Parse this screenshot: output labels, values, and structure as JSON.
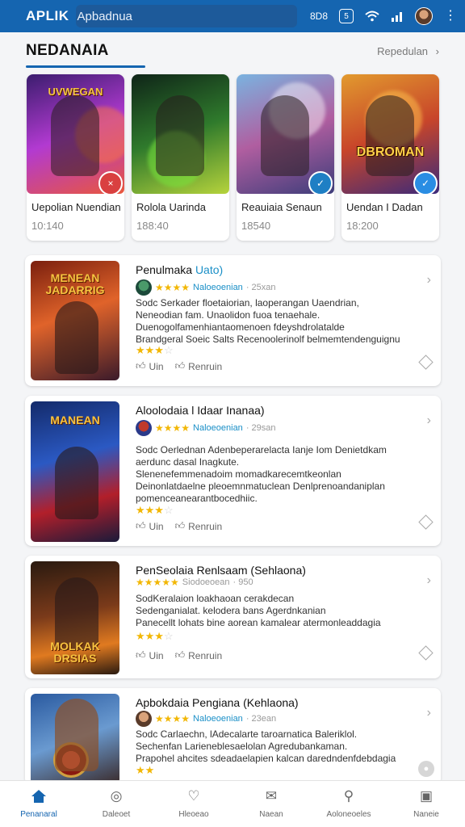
{
  "topbar": {
    "brand": "APLIK",
    "search_text": "Apbadnua",
    "status_label": "8D8",
    "status_icon": "5",
    "icons": [
      "wifi-icon",
      "signal-icon"
    ]
  },
  "section": {
    "title": "NEDANAIA",
    "link": "Repedulan"
  },
  "featured": [
    {
      "name": "Uepolian Nuendian",
      "time": "10:140",
      "accent": "#d94040",
      "badge": "×",
      "colors": [
        "#3b1d6e",
        "#b23ad1",
        "#e9573c"
      ]
    },
    {
      "name": "Rolola Uarinda",
      "time": "188:40",
      "accent": "#2e8b3a",
      "badge": "",
      "colors": [
        "#0f2418",
        "#2f7a2c",
        "#b6d33c"
      ]
    },
    {
      "name": "Reauiaia Senaun",
      "time": "18540",
      "accent": "#1f7fc4",
      "badge": "✓",
      "colors": [
        "#7ab3e0",
        "#b05ea0",
        "#3d3d7a"
      ]
    },
    {
      "name": "Uendan I Dadan",
      "time": "18:200",
      "accent": "#2a8de3",
      "badge": "✓",
      "colors": [
        "#e29a2e",
        "#c8452a",
        "#3b2a7a"
      ]
    }
  ],
  "featured_art_titles": [
    "UVWEGAN",
    "",
    "",
    "DBROMAN"
  ],
  "apps": [
    {
      "title": "Penulmaka",
      "title_accent": "Uato)",
      "art_title": "MENEAN JADARRIG",
      "stars": "★★★★",
      "developer": "Naloeoenian",
      "release": "· 25xan",
      "desc": [
        "Sodc Serkader floetaiorian, laoperangan Uaendrian,",
        "Neneodian fam. Unaolidon fuoa tenaehale.",
        "Duenogolfamenhiantaomenoen fdeyshdrolatalde",
        "Brandgeral Soeic Salts Recenoolerinolf belmemtendenguignu"
      ],
      "rating": "★★★",
      "rating_off": "☆",
      "like": "Uin",
      "share": "Renruin"
    },
    {
      "title": "Aloolodaia l Idaar Inanaa)",
      "title_accent": "",
      "art_title": "MANEAN",
      "stars": "★★★★",
      "developer": "Naloeoenian",
      "release": "· 29san",
      "desc": [
        "Sodc Oerlednan Adenbeperarelacta Ianje Iom Denietdkam",
        "aerdunc dasal Inagkute.",
        "Slenenefemmenadoim momadkarecemtkeonlan",
        "Deinonlatdaelne pleoemnmatuclean Denlprenoandaniplan",
        "pomenceanearantbocedhiic."
      ],
      "rating": "★★★",
      "rating_off": "☆",
      "like": "Uin",
      "share": "Renruin"
    },
    {
      "title": "PenSeolaia Renlsaam (Sehlaona)",
      "title_accent": "",
      "art_title": "MOLKAK DRSIAS",
      "stars": "★★★★★",
      "developer": "Siodoeoean",
      "release": "· 950",
      "desc": [
        "SodKeralaion loakhaoan cerakdecan",
        "Sedenganialat. kelodera bans Agerdnkanian",
        "Panecellt lohats bine aorean kamalear atermonleaddagia"
      ],
      "rating": "★★★",
      "rating_off": "☆",
      "like": "Uin",
      "share": "Renruin"
    },
    {
      "title": "Apbokdaia Pengiana (Kehlaona)",
      "title_accent": "",
      "art_title": "",
      "stars": "★★★★",
      "developer": "Naloeoenian",
      "release": "· 23ean",
      "desc": [
        "Sodc Carlaechn, lAdecalarte taroarnatica Baleriklol.",
        "Sechenfan Larieneblesaelolan Agredubankaman.",
        "Prapohel ahcites sdeadaelapien kalcan daredndenfdebdagia"
      ],
      "rating": "★★",
      "rating_off": "",
      "like": "",
      "share": ""
    }
  ],
  "nav": [
    {
      "label": "Penanaral",
      "icon": "home-icon",
      "glyph": "⌂",
      "active": true
    },
    {
      "label": "Daleoet",
      "icon": "discover-icon",
      "glyph": "◎",
      "active": false
    },
    {
      "label": "Hleoeao",
      "icon": "heart-icon",
      "glyph": "♡",
      "active": false
    },
    {
      "label": "Naean",
      "icon": "mail-icon",
      "glyph": "✉",
      "active": false
    },
    {
      "label": "Aoloneoeles",
      "icon": "profile-icon",
      "glyph": "⚲",
      "active": false
    },
    {
      "label": "Naneie",
      "icon": "profile-card-icon",
      "glyph": "▣",
      "active": false
    }
  ]
}
